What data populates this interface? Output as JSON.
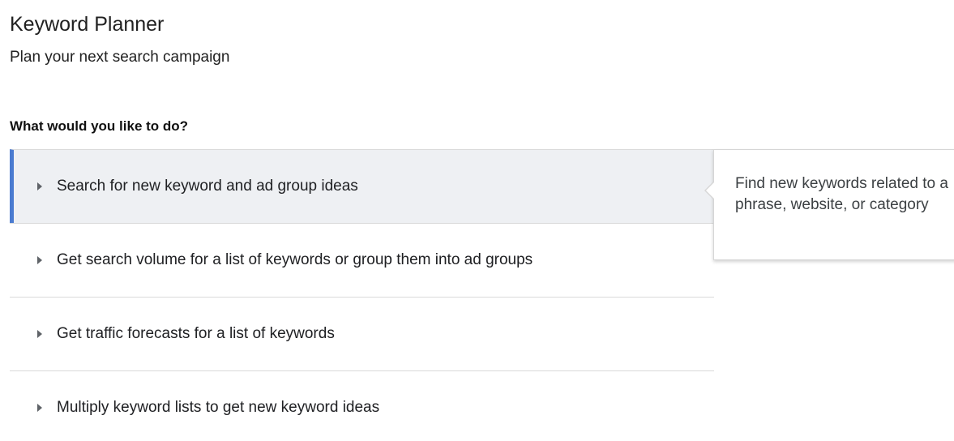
{
  "header": {
    "title": "Keyword Planner",
    "subtitle": "Plan your next search campaign"
  },
  "main": {
    "question": "What would you like to do?",
    "options": [
      {
        "label": "Search for new keyword and ad group ideas",
        "selected": true
      },
      {
        "label": "Get search volume for a list of keywords or group them into ad groups",
        "selected": false
      },
      {
        "label": "Get traffic forecasts for a list of keywords",
        "selected": false
      },
      {
        "label": "Multiply keyword lists to get new keyword ideas",
        "selected": false
      }
    ]
  },
  "tooltip": {
    "text": "Find new keywords related to a phrase, website, or category"
  },
  "colors": {
    "selected_accent": "#4a7bd0",
    "selected_background": "#eef0f3"
  },
  "icons": {
    "option_expand": "caret-right-icon"
  }
}
